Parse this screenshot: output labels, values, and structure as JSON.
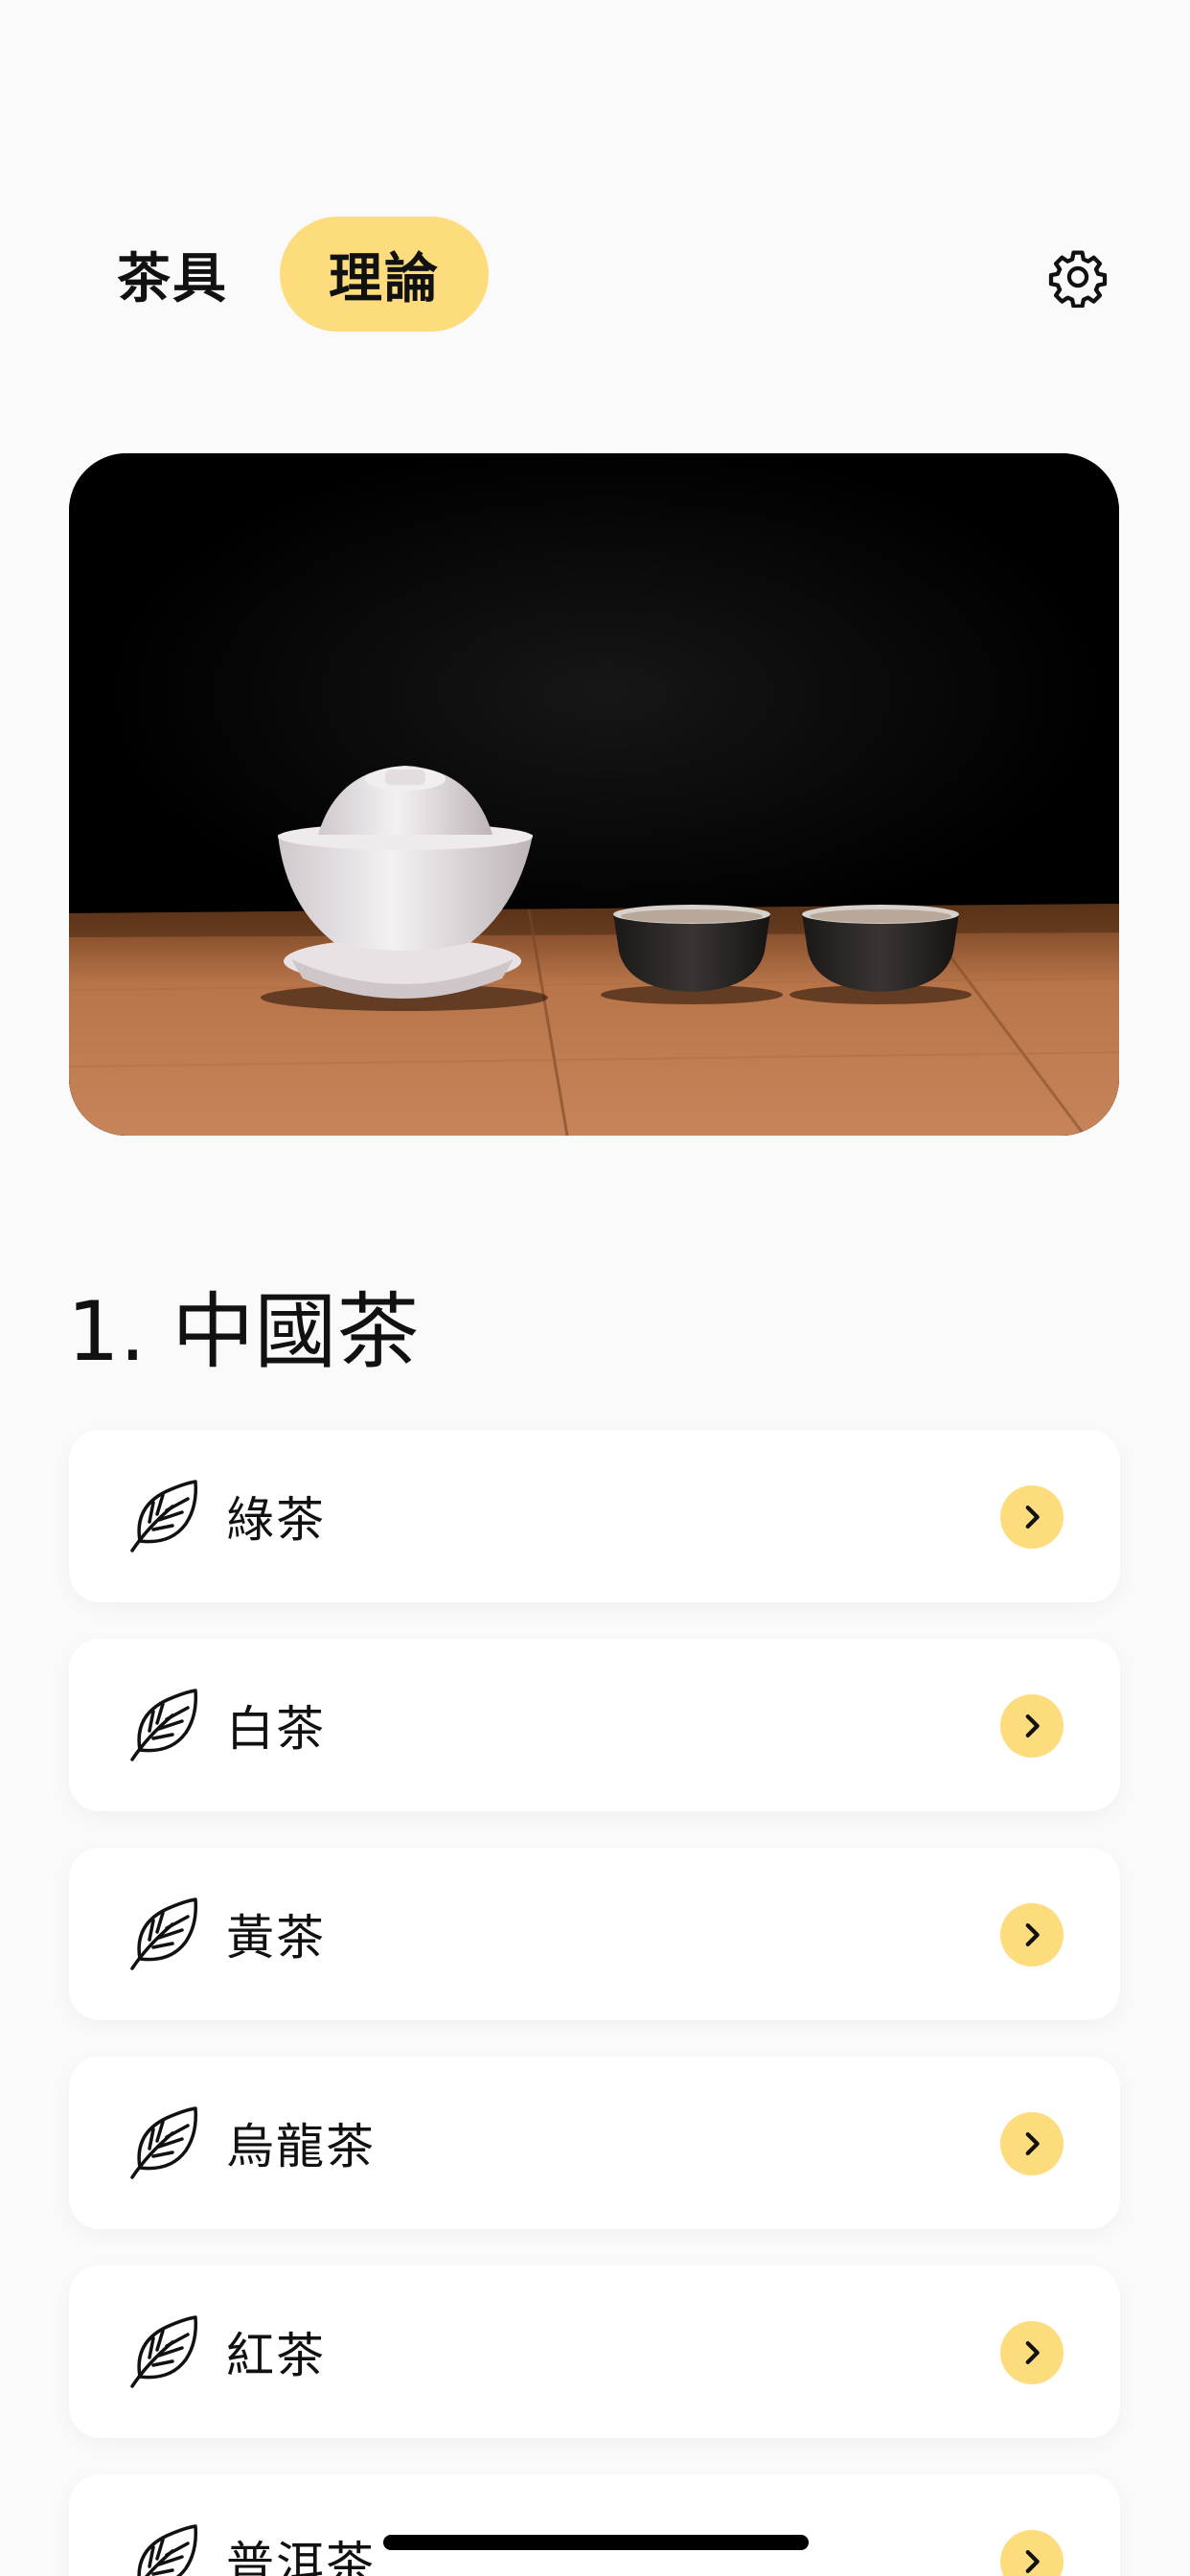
{
  "header": {
    "tabs": [
      {
        "label": "茶具",
        "active": false
      },
      {
        "label": "理論",
        "active": true
      }
    ],
    "settings_icon": "gear-icon"
  },
  "hero": {
    "image": "gaiwan-and-two-teacups-on-wooden-table"
  },
  "section": {
    "title": "1. 中國茶"
  },
  "tea_list": [
    {
      "label": "綠茶",
      "icon": "leaf-icon"
    },
    {
      "label": "白茶",
      "icon": "leaf-icon"
    },
    {
      "label": "黃茶",
      "icon": "leaf-icon"
    },
    {
      "label": "烏龍茶",
      "icon": "leaf-icon"
    },
    {
      "label": "紅茶",
      "icon": "leaf-icon"
    },
    {
      "label": "普洱茶",
      "icon": "leaf-icon"
    }
  ],
  "colors": {
    "accent": "#fddc7e",
    "background": "#fafafa",
    "card": "#ffffff",
    "text": "#111111"
  }
}
